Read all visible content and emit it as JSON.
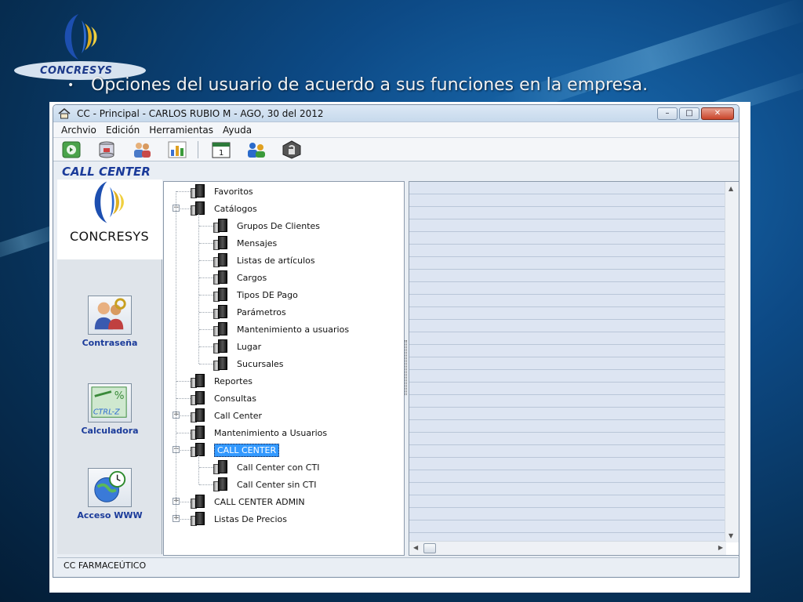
{
  "slide": {
    "logo_text": "CONCRESYS",
    "headline": "Opciones del usuario de acuerdo a sus funciones en la empresa.",
    "bullet": "•"
  },
  "window": {
    "title": "CC - Principal - CARLOS RUBIO M - AGO, 30 del 2012",
    "controls": {
      "minimize": "–",
      "maximize": "□",
      "close": "✕"
    }
  },
  "menu": [
    "Archvio",
    "Edición",
    "Herramientas",
    "Ayuda"
  ],
  "toolbar": [
    "exit-icon",
    "database-icon",
    "users-icon",
    "chart-icon",
    "calendar-icon",
    "group-icon",
    "lock-icon"
  ],
  "app_label": "CALL CENTER",
  "left_logo_text": "CONCRESYS",
  "nav": [
    {
      "label": "Contraseña",
      "icon": "password-icon"
    },
    {
      "label": "Calculadora",
      "icon": "calculator-icon",
      "icon_text": "CTRL-Z"
    },
    {
      "label": "Acceso WWW",
      "icon": "web-access-icon"
    }
  ],
  "tree": [
    {
      "label": "Favoritos",
      "level": 0
    },
    {
      "label": "Catálogos",
      "level": 0,
      "expander": "−"
    },
    {
      "label": "Grupos De Clientes",
      "level": 1
    },
    {
      "label": "Mensajes",
      "level": 1
    },
    {
      "label": "Listas de artículos",
      "level": 1
    },
    {
      "label": "Cargos",
      "level": 1
    },
    {
      "label": "Tipos DE Pago",
      "level": 1
    },
    {
      "label": "Parámetros",
      "level": 1
    },
    {
      "label": "Mantenimiento a usuarios",
      "level": 1
    },
    {
      "label": "Lugar",
      "level": 1
    },
    {
      "label": "Sucursales",
      "level": 1
    },
    {
      "label": "Reportes",
      "level": 0
    },
    {
      "label": "Consultas",
      "level": 0
    },
    {
      "label": "Call Center",
      "level": 0,
      "expander": "+"
    },
    {
      "label": "Mantenimiento a Usuarios",
      "level": 0
    },
    {
      "label": "CALL CENTER",
      "level": 0,
      "expander": "−",
      "selected": true
    },
    {
      "label": "Call Center con CTI",
      "level": 1
    },
    {
      "label": "Call Center sin CTI",
      "level": 1
    },
    {
      "label": "CALL CENTER ADMIN",
      "level": 0,
      "expander": "+"
    },
    {
      "label": "Listas De Precios",
      "level": 0,
      "expander": "+"
    }
  ],
  "status": "CC FARMACEÚTICO",
  "colors": {
    "accent": "#1b3b9a",
    "selection": "#3399ff"
  }
}
